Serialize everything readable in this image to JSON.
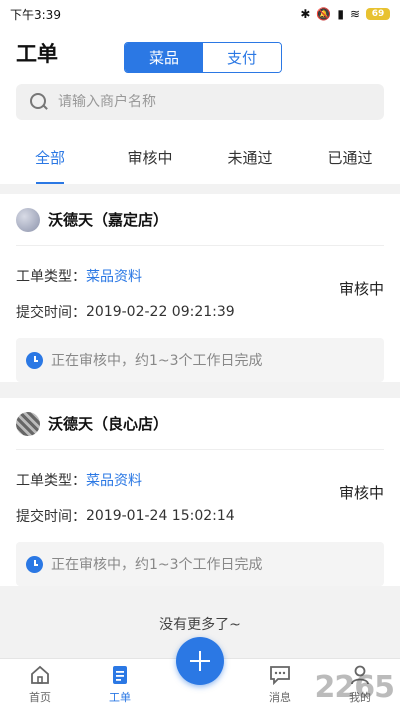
{
  "status_bar": {
    "time": "下午3:39",
    "battery": "69"
  },
  "header": {
    "title": "工单",
    "segments": [
      "菜品",
      "支付"
    ]
  },
  "search": {
    "placeholder": "请输入商户名称"
  },
  "tabs": [
    "全部",
    "审核中",
    "未通过",
    "已通过"
  ],
  "cards": [
    {
      "store": "沃德天（嘉定店）",
      "type_label": "工单类型：",
      "type_value": "菜品资料",
      "time_label": "提交时间：",
      "time_value": "2019-02-22 09:21:39",
      "state": "审核中",
      "notice": "正在审核中，约1~3个工作日完成"
    },
    {
      "store": "沃德天（良心店）",
      "type_label": "工单类型：",
      "type_value": "菜品资料",
      "time_label": "提交时间：",
      "time_value": "2019-01-24 15:02:14",
      "state": "审核中",
      "notice": "正在审核中，约1~3个工作日完成"
    }
  ],
  "no_more": "没有更多了~",
  "tabbar": {
    "home": "首页",
    "orders": "工单",
    "messages": "消息",
    "mine": "我的"
  },
  "watermark": "2265",
  "colors": {
    "accent": "#2b78e4"
  }
}
